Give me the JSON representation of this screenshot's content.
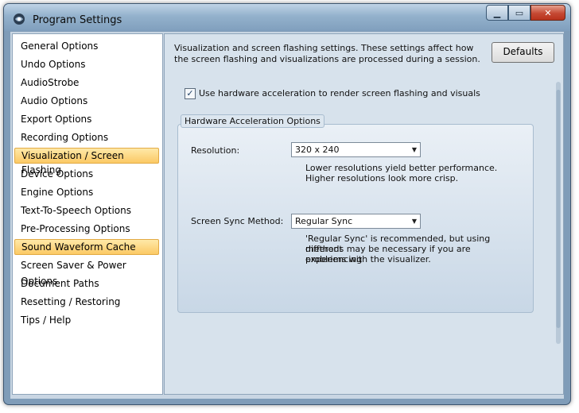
{
  "window": {
    "title": "Program Settings"
  },
  "caption": {
    "minimize": "▁",
    "maximize": "▭",
    "close": "✕"
  },
  "sidebar": {
    "items": [
      {
        "label": "General Options",
        "highlight": false
      },
      {
        "label": "Undo Options",
        "highlight": false
      },
      {
        "label": "AudioStrobe",
        "highlight": false
      },
      {
        "label": "Audio Options",
        "highlight": false
      },
      {
        "label": "Export Options",
        "highlight": false
      },
      {
        "label": "Recording Options",
        "highlight": false
      },
      {
        "label": "Visualization / Screen Flashing",
        "highlight": true
      },
      {
        "label": "Device Options",
        "highlight": false
      },
      {
        "label": "Engine Options",
        "highlight": false
      },
      {
        "label": "Text-To-Speech Options",
        "highlight": false
      },
      {
        "label": "Pre-Processing Options",
        "highlight": false
      },
      {
        "label": "Sound Waveform Cache",
        "highlight": true
      },
      {
        "label": "Screen Saver & Power Options",
        "highlight": false
      },
      {
        "label": "Document Paths",
        "highlight": false
      },
      {
        "label": "Resetting / Restoring",
        "highlight": false
      },
      {
        "label": "Tips / Help",
        "highlight": false
      }
    ]
  },
  "main": {
    "description": "Visualization and screen flashing settings. These settings affect how the screen flashing and visualizations are processed during a session.",
    "defaults_button": "Defaults",
    "hw_checkbox": {
      "label": "Use hardware acceleration to render screen flashing and visuals",
      "checked": true,
      "mark": "✓"
    },
    "group": {
      "title": "Hardware Acceleration Options",
      "resolution": {
        "label": "Resolution:",
        "value": "320 x 240",
        "hint_1": "Lower resolutions yield better performance.",
        "hint_2": "Higher resolutions look more crisp."
      },
      "sync": {
        "label": "Screen Sync Method:",
        "value": "Regular Sync",
        "hint_1": "'Regular Sync' is recommended, but using different",
        "hint_2": "methods may be necessary if you are experiencing",
        "hint_3": "problems with the visualizer."
      }
    }
  },
  "colors": {
    "accent_highlight": "#fbc965",
    "title_bar": "#93b1cc",
    "close_button": "#c54933"
  }
}
